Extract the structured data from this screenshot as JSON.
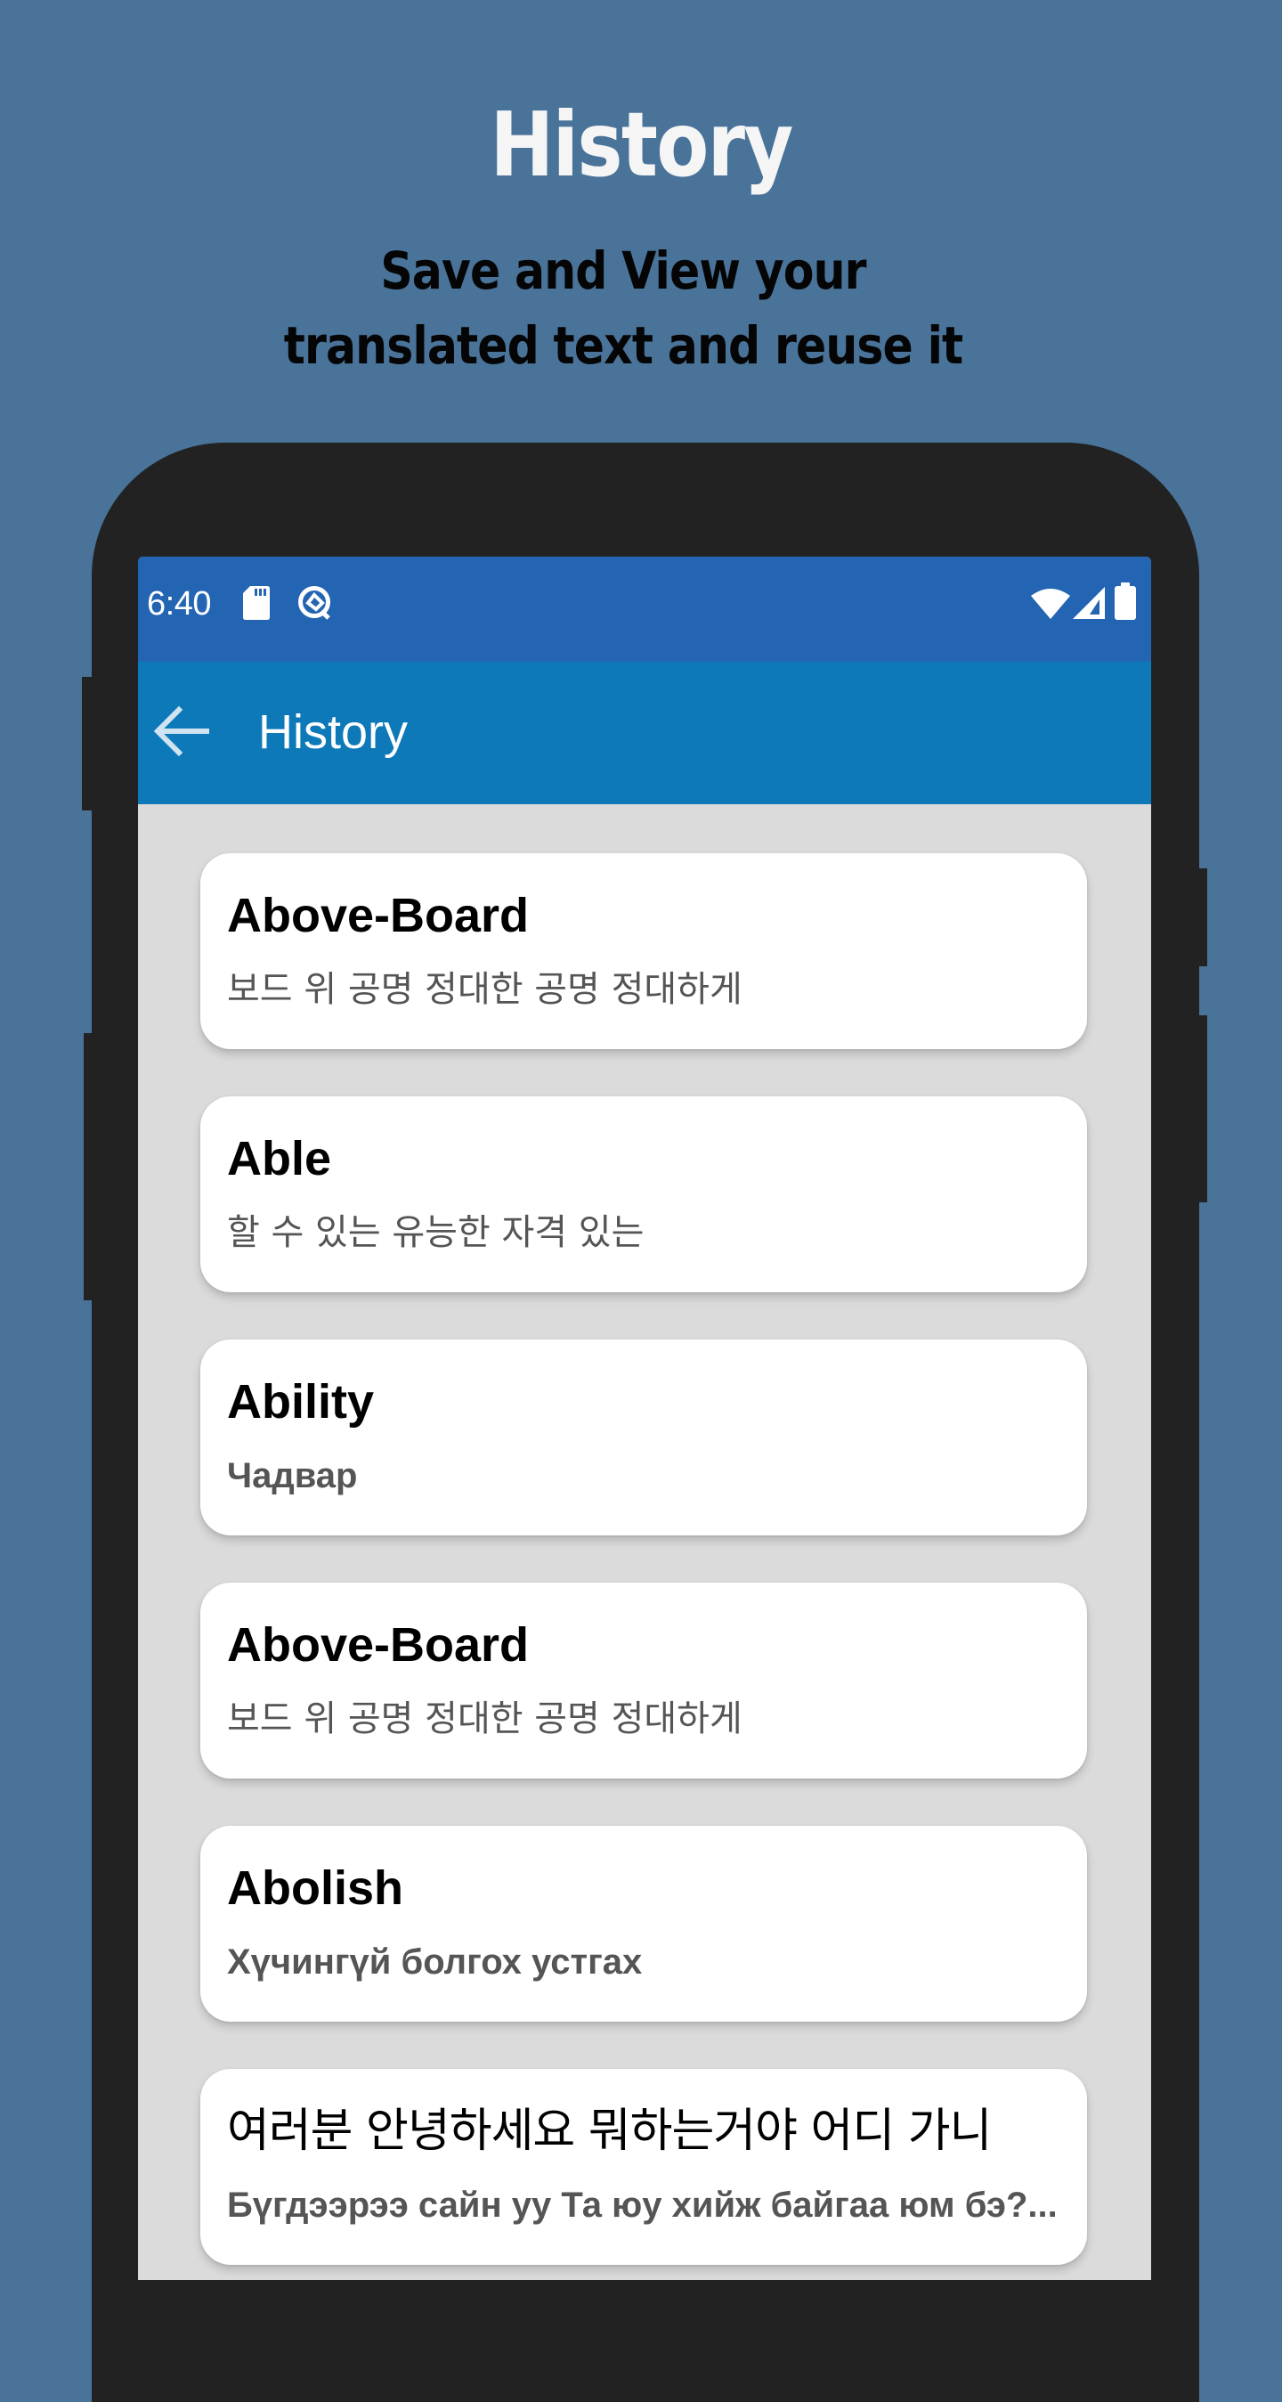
{
  "promo": {
    "title": "History",
    "subtitle": "Save and View your translated text and reuse it"
  },
  "status_bar": {
    "time": "6:40",
    "left_icons": [
      "sd-card-icon",
      "data-saver-icon"
    ],
    "right_icons": [
      "wifi-icon",
      "cell-signal-icon",
      "battery-icon"
    ]
  },
  "app_bar": {
    "back_icon": "arrow-back-icon",
    "title": "History"
  },
  "colors": {
    "background": "#4a7399",
    "status_bar": "#2465b3",
    "app_bar": "#0e79b8",
    "list_background": "#dbdbdb",
    "card": "#ffffff",
    "subtitle_text": "#555555"
  },
  "history": {
    "items": [
      {
        "word": "Above-Board",
        "translation": "보드 위  공명 정대한 공명 정대하게",
        "script": "hangul"
      },
      {
        "word": "Able",
        "translation": "할 수 있는  유능한 자격 있는",
        "script": "hangul"
      },
      {
        "word": "Ability",
        "translation": "Чадвар",
        "script": "cyrillic"
      },
      {
        "word": "Above-Board",
        "translation": "보드 위  공명 정대한 공명 정대하게",
        "script": "hangul"
      },
      {
        "word": "Abolish",
        "translation": "Хүчингүй болгох  устгах",
        "script": "cyrillic"
      },
      {
        "word": "여러분 안녕하세요 뭐하는거야 어디 가니",
        "translation": "Бүгдээрээ сайн уу Та юу хийж байгаа юм бэ?...",
        "script": "cyrillic"
      }
    ]
  }
}
